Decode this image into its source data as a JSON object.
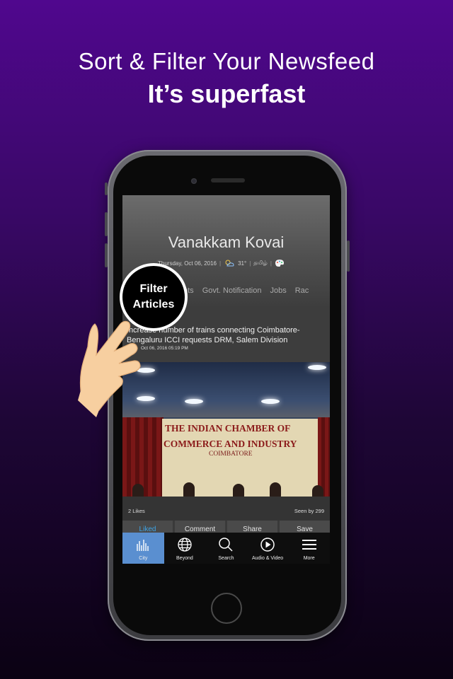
{
  "promo": {
    "headline": "Sort & Filter Your Newsfeed",
    "subheadline": "It’s superfast"
  },
  "app": {
    "title": "Vanakkam Kovai",
    "info": {
      "date": "Thursday, Oct 06, 2016",
      "temperature": "31°",
      "language": "தமிழ்"
    },
    "categories": [
      "nts",
      "Govt. Notification",
      "Jobs",
      "Rac"
    ],
    "article": {
      "title": "Increase number of trains connecting Coimbatore-Bengaluru ICCI requests DRM, Salem Division",
      "time": "Oct 06, 2016 05:19 PM",
      "image_text": {
        "line1": "THE INDIAN CHAMBER OF",
        "line2": "COMMERCE AND INDUSTRY",
        "line3": "COIMBATORE"
      },
      "likes": "2 Likes",
      "seen": "Seen by 299"
    },
    "actions": [
      "Liked",
      "Comment",
      "Share",
      "Save"
    ],
    "tabs": [
      {
        "label": "City",
        "icon": "city-skyline-icon",
        "active": true
      },
      {
        "label": "Beyond",
        "icon": "globe-icon",
        "active": false
      },
      {
        "label": "Search",
        "icon": "search-icon",
        "active": false
      },
      {
        "label": "Audio & Video",
        "icon": "play-circle-icon",
        "active": false
      },
      {
        "label": "More",
        "icon": "hamburger-menu-icon",
        "active": false
      }
    ]
  },
  "overlay": {
    "callout": [
      "Filter",
      "Articles"
    ]
  },
  "colors": {
    "background_top": "#50078e",
    "background_bottom": "#0b0213",
    "active_tab": "#5a8fd0",
    "liked": "#3ea4e6"
  }
}
